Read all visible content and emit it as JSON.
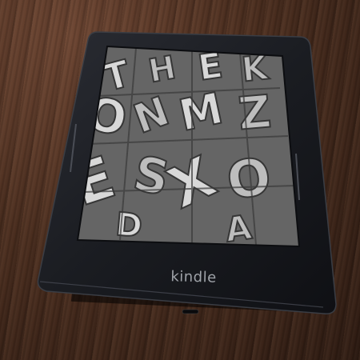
{
  "device": {
    "brand_text": "kindle",
    "bezel_color": "#1b1d22",
    "screen_tint": "#6f6f6f"
  },
  "screen_art": {
    "letters": [
      "T",
      "H",
      "E",
      "K",
      "O",
      "N",
      "M",
      "Z",
      "E",
      "S",
      "X",
      "O",
      "D",
      "A"
    ]
  },
  "environment": {
    "surface": "wooden table",
    "wood_color": "#4a2d1e"
  }
}
